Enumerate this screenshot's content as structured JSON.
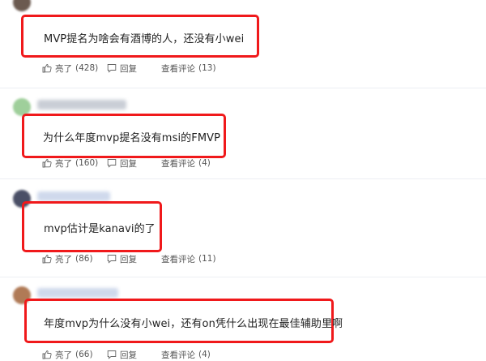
{
  "comments": [
    {
      "text": "MVP提名为啥会有酒博的人，还没有小wei",
      "like_label": "亮了",
      "like_count": "(428)",
      "reply_label": "回复",
      "view_replies_label": "查看评论",
      "reply_count": "(13)"
    },
    {
      "text": "为什么年度mvp提名没有msi的FMVP",
      "like_label": "亮了",
      "like_count": "(160)",
      "reply_label": "回复",
      "view_replies_label": "查看评论",
      "reply_count": "(4)"
    },
    {
      "text": "mvp估计是kanavi的了",
      "like_label": "亮了",
      "like_count": "(86)",
      "reply_label": "回复",
      "view_replies_label": "查看评论",
      "reply_count": "(11)"
    },
    {
      "text": "年度mvp为什么没有小wei，还有on凭什么出现在最佳辅助里啊",
      "like_label": "亮了",
      "like_count": "(66)",
      "reply_label": "回复",
      "view_replies_label": "查看评论",
      "reply_count": "(4)"
    }
  ],
  "colors": {
    "highlight": "#f0191b",
    "text": "#222222",
    "meta": "#555555"
  },
  "icons": {
    "like": "thumbs-up-icon",
    "reply": "reply-icon"
  }
}
